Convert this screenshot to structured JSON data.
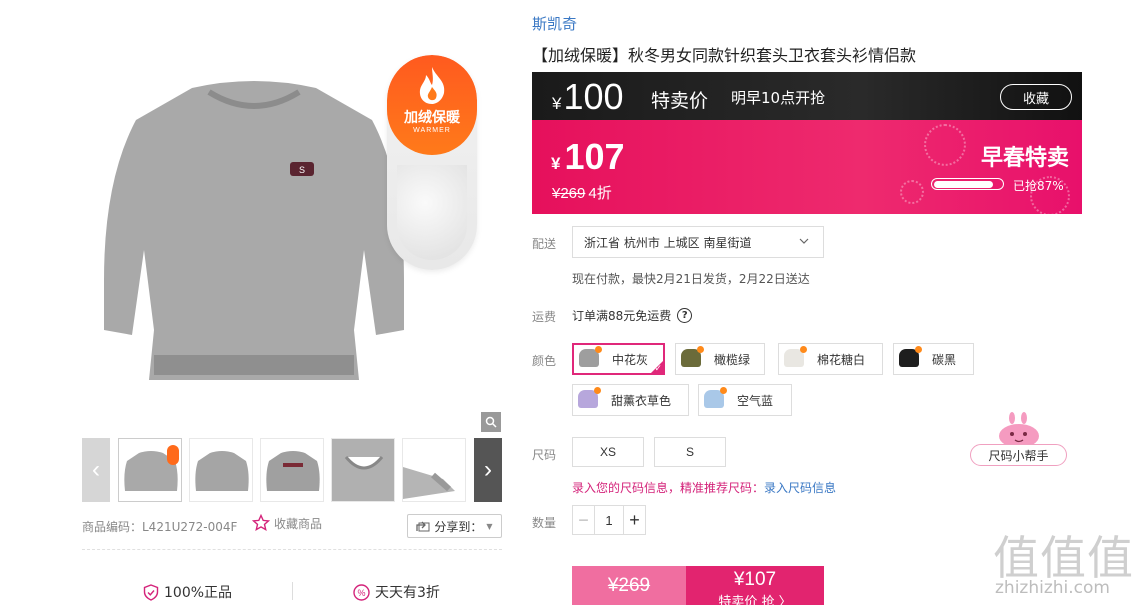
{
  "gallery": {
    "badge_title": "加绒保暖",
    "badge_sub": "WARMER",
    "product_code": "商品编码：L421U272-004F",
    "favorite_label": "收藏商品",
    "share_label": "分享到：",
    "guarantees": [
      "100%正品",
      "天天有3折"
    ]
  },
  "product": {
    "brand": "斯凯奇",
    "title": "【加绒保暖】秋冬男女同款针织套头卫衣套头衫情侣款"
  },
  "promo": {
    "currency": "¥",
    "price": "100",
    "label": "特卖价",
    "time": "明早10点开抢",
    "collect": "收藏"
  },
  "price": {
    "currency": "¥",
    "now": "107",
    "original": "¥269",
    "discount": "4折",
    "event": "早春特卖",
    "sold_text": "已抢87%",
    "sold_ratio": 0.87
  },
  "delivery": {
    "label": "配送",
    "address": "浙江省 杭州市 上城区 南星街道",
    "ship_text": "现在付款，最快2月21日发货，2月22日送达"
  },
  "freight": {
    "label": "运费",
    "text": "订单满88元免运费"
  },
  "colors": {
    "label": "颜色",
    "options": [
      {
        "name": "中花灰",
        "swatch": "#9e9e9e",
        "selected": true
      },
      {
        "name": "橄榄绿",
        "swatch": "#6b6b3a",
        "selected": false
      },
      {
        "name": "棉花糖白",
        "swatch": "#e9e7e2",
        "selected": false
      },
      {
        "name": "碳黑",
        "swatch": "#1e1e1e",
        "selected": false
      },
      {
        "name": "甜薰衣草色",
        "swatch": "#b7a7dc",
        "selected": false
      },
      {
        "name": "空气蓝",
        "swatch": "#a9c8e8",
        "selected": false
      }
    ]
  },
  "sizes": {
    "label": "尺码",
    "options": [
      "XS",
      "S"
    ],
    "helper": "尺码小帮手",
    "tip_prefix": "录入您的尺码信息，精准推荐尺码：",
    "tip_link": "录入尺码信息"
  },
  "quantity": {
    "label": "数量",
    "value": "1",
    "minus": "−",
    "plus": "+"
  },
  "buy": {
    "original": "¥269",
    "price": "¥107",
    "action": "特卖价 抢 〉"
  },
  "watermark": {
    "glyphs": "值值值",
    "url": "zhizhizhi.com"
  }
}
